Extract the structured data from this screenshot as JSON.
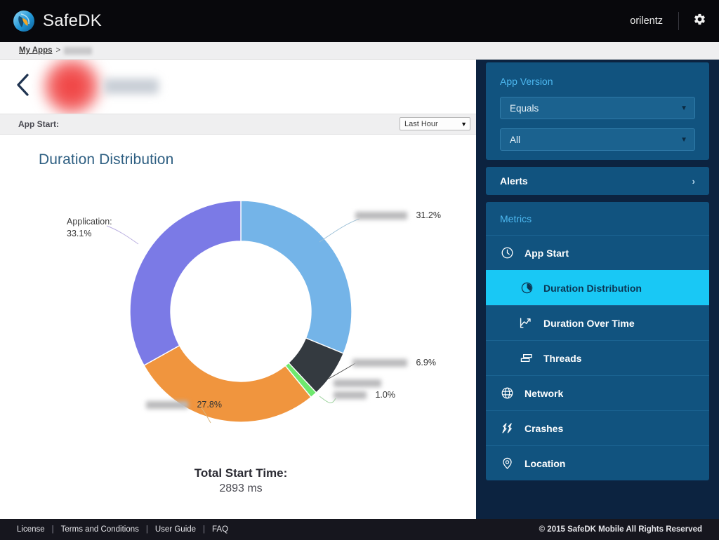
{
  "header": {
    "brand": "SafeDK",
    "user": "orilentz",
    "settings_icon": "gear-icon"
  },
  "breadcrumb": {
    "root": "My Apps",
    "separator": ">",
    "current": ""
  },
  "app_band": {
    "back_icon": "chevron-left-icon",
    "app_name": ""
  },
  "sub_band": {
    "label": "App Start:",
    "range_value": "Last Hour",
    "caret": "▼"
  },
  "chart": {
    "title": "Duration Distribution",
    "center_line1": "Total Start Time:",
    "center_line2": "2893 ms"
  },
  "chart_data": {
    "type": "pie",
    "title": "Duration Distribution",
    "subtitle": "Total Start Time: 2893 ms",
    "total_label": "Total Start Time:",
    "total_value": "2893 ms",
    "donut": true,
    "legend": "labels-with-leader-lines",
    "categories": [
      "",
      "",
      "",
      "",
      "Application"
    ],
    "values": [
      31.2,
      6.9,
      1.0,
      27.8,
      33.1
    ],
    "value_labels": [
      "31.2%",
      "6.9%",
      "1.0%",
      "27.8%",
      "33.1%"
    ],
    "redacted": [
      true,
      true,
      true,
      true,
      false
    ],
    "colors": [
      "#74b4e8",
      "#343a40",
      "#6ee86e",
      "#f0953e",
      "#7b7ae6"
    ],
    "slices": [
      {
        "label": "",
        "redacted": true,
        "value": 31.2,
        "value_label": "31.2%",
        "color": "#74b4e8"
      },
      {
        "label": "",
        "redacted": true,
        "value": 6.9,
        "value_label": "6.9%",
        "color": "#343a40"
      },
      {
        "label": "",
        "redacted": true,
        "value": 1.0,
        "value_label": "1.0%",
        "color": "#6ee86e"
      },
      {
        "label": "",
        "redacted": true,
        "value": 27.8,
        "value_label": "27.8%",
        "color": "#f0953e"
      },
      {
        "label": "Application:",
        "redacted": false,
        "value": 33.1,
        "value_label": "33.1%",
        "color": "#7b7ae6"
      }
    ],
    "labels_text": {
      "application": "Application:",
      "application_pct": "33.1%",
      "slice1_pct": "31.2%",
      "slice2_pct": "6.9%",
      "slice3_pct": "1.0%",
      "slice4_pct": "27.8%"
    }
  },
  "sidebar": {
    "app_version": {
      "title": "App Version",
      "operator": "Equals",
      "value": "All",
      "caret": "▼"
    },
    "alerts": {
      "label": "Alerts",
      "chevron": "›"
    },
    "metrics": {
      "title": "Metrics",
      "items": [
        {
          "label": "App Start",
          "icon": "clock-icon",
          "sub": false,
          "active": false
        },
        {
          "label": "Duration Distribution",
          "icon": "pie-chart-icon",
          "sub": true,
          "active": true
        },
        {
          "label": "Duration Over Time",
          "icon": "line-chart-icon",
          "sub": true,
          "active": false
        },
        {
          "label": "Threads",
          "icon": "threads-icon",
          "sub": true,
          "active": false
        },
        {
          "label": "Network",
          "icon": "globe-icon",
          "sub": false,
          "active": false
        },
        {
          "label": "Crashes",
          "icon": "crash-icon",
          "sub": false,
          "active": false
        },
        {
          "label": "Location",
          "icon": "location-pin-icon",
          "sub": false,
          "active": false
        }
      ]
    }
  },
  "footer": {
    "links": [
      "License",
      "Terms and Conditions",
      "User Guide",
      "FAQ"
    ],
    "separator": "|",
    "copyright": "© 2015 SafeDK Mobile All Rights Reserved"
  },
  "colors": {
    "accent_cyan": "#19c8f5",
    "sidebar_bg": "#0c2340",
    "card_bg": "#11537f",
    "title_blue": "#2e5f82"
  }
}
